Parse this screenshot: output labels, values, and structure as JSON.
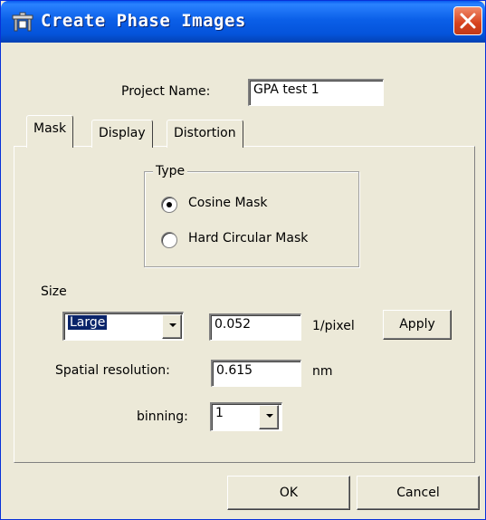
{
  "window": {
    "title": "Create Phase Images",
    "title_icon": "app-window-icon",
    "close_icon": "close-icon"
  },
  "project": {
    "label": "Project Name:",
    "value": "GPA test 1"
  },
  "tabs": [
    {
      "label": "Mask",
      "selected": true
    },
    {
      "label": "Display",
      "selected": false
    },
    {
      "label": "Distortion",
      "selected": false
    }
  ],
  "type_group": {
    "title": "Type",
    "options": [
      {
        "label": "Cosine Mask",
        "selected": true
      },
      {
        "label": "Hard Circular Mask",
        "selected": false
      }
    ]
  },
  "size": {
    "label": "Size",
    "preset_value": "Large",
    "mask_value": "0.052",
    "unit": "1/pixel",
    "apply_label": "Apply"
  },
  "spatial": {
    "label": "Spatial resolution:",
    "value": "0.615",
    "unit": "nm"
  },
  "binning": {
    "label": "binning:",
    "value": "1"
  },
  "footer": {
    "ok_label": "OK",
    "cancel_label": "Cancel"
  },
  "colors": {
    "titlebar": "#0453da",
    "dialog_bg": "#ece9d8",
    "close_button": "#d6421e",
    "selection": "#0a246a"
  }
}
